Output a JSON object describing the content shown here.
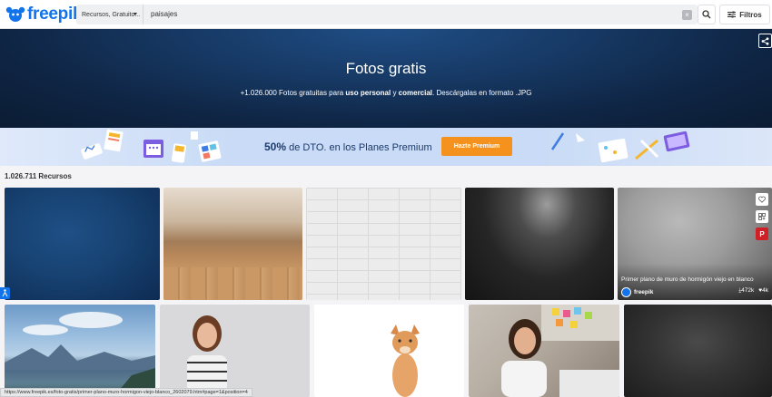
{
  "header": {
    "logo_text": "freepik",
    "category_label": "Recursos, Gratuito...",
    "search_query": "paisajes",
    "clear_label": "×",
    "filters_label": "Filtros"
  },
  "hero": {
    "title": "Fotos gratis",
    "subtitle_start": "+1.026.000 Fotos gratuitas para ",
    "subtitle_bold1": "uso personal",
    "subtitle_mid": " y ",
    "subtitle_bold2": "comercial",
    "subtitle_end": ". Descárgalas en formato .JPG"
  },
  "promo": {
    "discount": "50%",
    "text": " de DTO. en los Planes Premium",
    "button_label": "Hazte Premium"
  },
  "results": {
    "count_label": "1.026.711 Recursos"
  },
  "featured_tile": {
    "title": "Primer plano de muro de hormigón viejo en blanco",
    "author": "freepik",
    "downloads": "472k",
    "likes": "4k"
  },
  "status_bar": {
    "url": "https://www.freepik.es/foto-gratis/primer-plano-muro-hormigon-viejo-blanco_2602079.htm#page=1&position=4"
  },
  "colors": {
    "brand": "#1273eb",
    "promo_button": "#f5921e",
    "pinterest": "#cf2027"
  }
}
